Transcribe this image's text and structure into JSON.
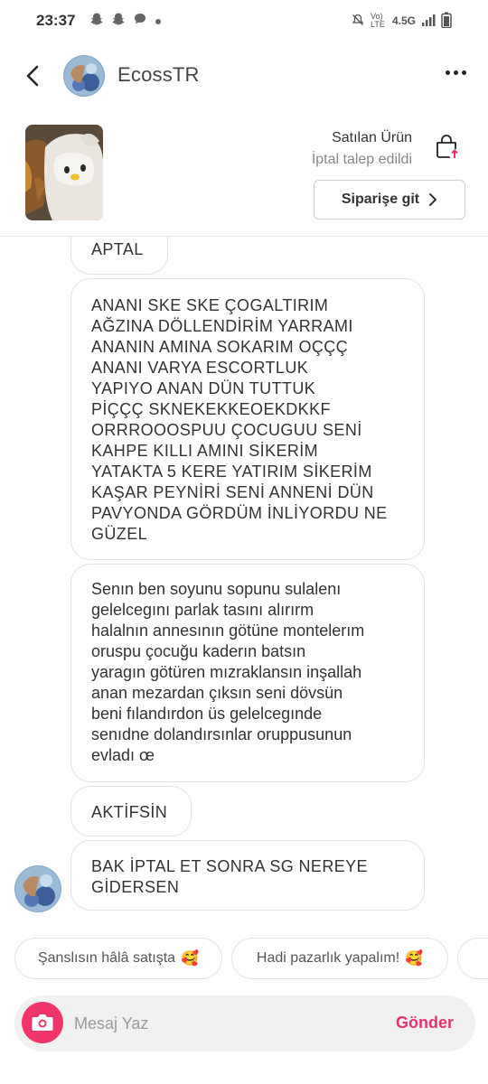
{
  "status_bar": {
    "time": "23:37",
    "left_icons": [
      "snapchat-icon",
      "snapchat-icon",
      "chat-bubble-icon",
      "dot-icon"
    ],
    "network": "4.5G",
    "volte": "Vo) LTE",
    "right_icons": [
      "mute-icon",
      "signal-icon",
      "battery-icon"
    ]
  },
  "header": {
    "title": "EcossTR"
  },
  "product": {
    "sold_label": "Satılan Ürün",
    "status_label": "İptal talep edildi",
    "order_button_label": "Siparişe git"
  },
  "messages": [
    {
      "text": "APTAL"
    },
    {
      "text": "ANANI SKE SKE ÇOGALTIRIM\nAĞZINA DÖLLENDİRİM YARRAMI\nANANIN AMINA SOKARIM OÇÇÇ\nANANI VARYA ESCORTLUK\nYAPIYO ANAN DÜN TUTTUK\nPİÇÇÇ SKNEKEKKEOEKDKKF\nORRROOOSPUU ÇOCUGUU SENİ\nKAHPE KILLI AMINI SİKERİM\nYATAKTA 5 KERE YATIRIM SİKERİM\nKAŞAR PEYNİRİ SENİ ANNENİ DÜN\nPAVYONDA GÖRDÜM İNLİYORDU NE\nGÜZEL"
    },
    {
      "text": "Senın ben soyunu sopunu sulalenı\ngelelcegını parlak tasını alırırm\nhalalnın annesının götüne montelerım\noruspu çocuğu kaderın batsın\nyaragın götüren mızraklansın inşallah\nanan mezardan çıksın seni dövsün\nbeni fılandırdon üs gelelcegınde\nsenıdne dolandırsınlar oruppusunun\nevladı œ"
    },
    {
      "text": "AKTİFSİN"
    },
    {
      "text": "BAK İPTAL ET SONRA SG NEREYE\nGİDERSEN"
    }
  ],
  "quick_replies": [
    {
      "label": "Şanslısın hâlâ satışta",
      "emoji": "🥰"
    },
    {
      "label": "Hadi pazarlık yapalım!",
      "emoji": "🥰"
    }
  ],
  "composer": {
    "placeholder": "Mesaj Yaz",
    "send_label": "Gönder"
  },
  "colors": {
    "accent": "#e8336d",
    "camera_button": "#f0356b",
    "bubble_border": "#e2e2e2",
    "composer_bg": "#f1f1f1"
  }
}
